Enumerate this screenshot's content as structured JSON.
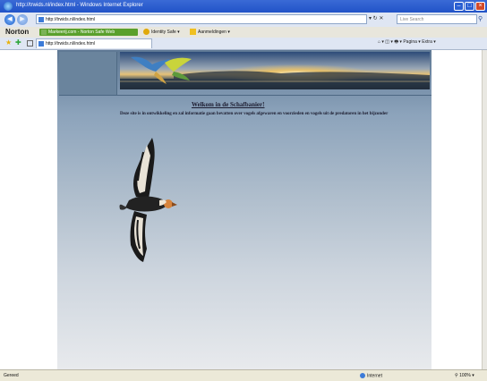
{
  "window": {
    "title": "http://trwids.nl/index.html - Windows Internet Explorer"
  },
  "address_bar": {
    "url": "http://trwids.nl/index.html",
    "search_placeholder": "Live Search"
  },
  "norton_toolbar": {
    "brand": "Norton",
    "safe_web": "Markeerij.com - Norton Safe Web",
    "identity_safe": "Identity Safe",
    "accounts": "Aanmeldingen"
  },
  "tab_bar": {
    "tab_title": "http://trwids.nl/index.html",
    "tools": "Pagina ▾  Extra ▾"
  },
  "page": {
    "heading": "Welkom in de Schafbanier!",
    "intro": "Deze site is in ontwikkeling en zal informatie gaan bevatten over vogels afgewaren en voorzieden en vogels uit de predatoren in het bijzonder"
  },
  "status_bar": {
    "left": "Gereed",
    "zone": "Internet",
    "zoom": "100%"
  }
}
